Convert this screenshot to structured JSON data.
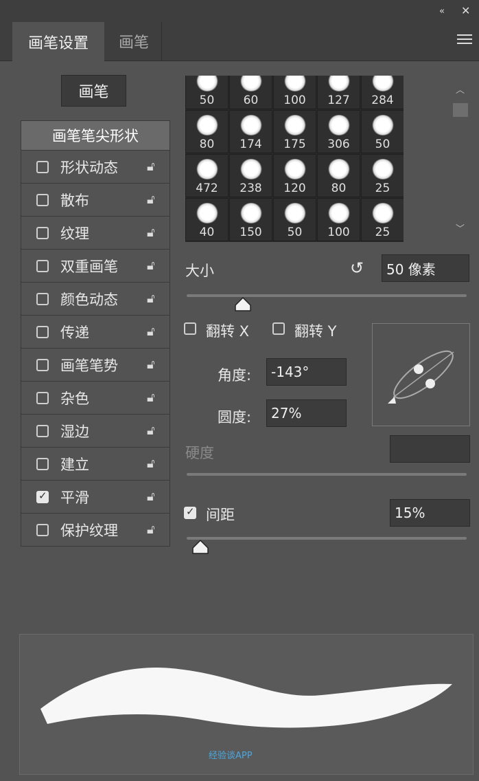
{
  "window": {
    "collapse_icon": "«",
    "close_icon": "✕"
  },
  "tabs": [
    {
      "label": "画笔设置",
      "active": true
    },
    {
      "label": "画笔",
      "active": false
    }
  ],
  "brush_button": "画笔",
  "tip_shape_header": "画笔笔尖形状",
  "options": [
    {
      "label": "形状动态",
      "checked": false
    },
    {
      "label": "散布",
      "checked": false
    },
    {
      "label": "纹理",
      "checked": false
    },
    {
      "label": "双重画笔",
      "checked": false
    },
    {
      "label": "颜色动态",
      "checked": false
    },
    {
      "label": "传递",
      "checked": false
    },
    {
      "label": "画笔笔势",
      "checked": false
    },
    {
      "label": "杂色",
      "checked": false
    },
    {
      "label": "湿边",
      "checked": false
    },
    {
      "label": "建立",
      "checked": false
    },
    {
      "label": "平滑",
      "checked": true
    },
    {
      "label": "保护纹理",
      "checked": false
    }
  ],
  "brushes": [
    {
      "size": "50"
    },
    {
      "size": "60"
    },
    {
      "size": "100"
    },
    {
      "size": "127"
    },
    {
      "size": "284"
    },
    {
      "size": "80"
    },
    {
      "size": "174"
    },
    {
      "size": "175"
    },
    {
      "size": "306"
    },
    {
      "size": "50"
    },
    {
      "size": "472"
    },
    {
      "size": "238"
    },
    {
      "size": "120"
    },
    {
      "size": "80"
    },
    {
      "size": "25"
    },
    {
      "size": "40"
    },
    {
      "size": "150"
    },
    {
      "size": "50"
    },
    {
      "size": "100"
    },
    {
      "size": "25"
    }
  ],
  "size": {
    "label": "大小",
    "value": "50 像素",
    "reset_icon": "↺",
    "slider_fraction": 0.2
  },
  "flip_x": {
    "label": "翻转 X",
    "checked": false
  },
  "flip_y": {
    "label": "翻转 Y",
    "checked": false
  },
  "angle": {
    "label": "角度:",
    "value": "-143°"
  },
  "roundness": {
    "label": "圆度:",
    "value": "27%"
  },
  "hardness": {
    "label": "硬度",
    "value": ""
  },
  "spacing": {
    "label": "间距",
    "checked": true,
    "value": "15%",
    "slider_fraction": 0.05
  },
  "watermark": "经验谈APP"
}
